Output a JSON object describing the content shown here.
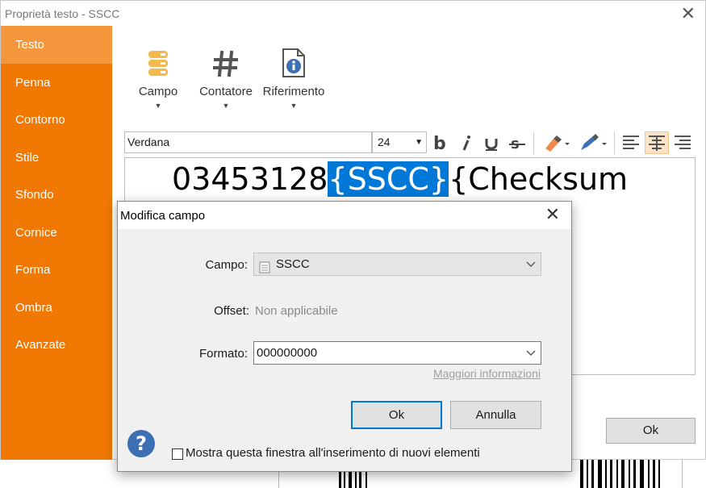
{
  "window": {
    "title": "Proprietà testo - SSCC",
    "close": "✕"
  },
  "sidebar": {
    "items": [
      {
        "label": "Testo"
      },
      {
        "label": "Penna"
      },
      {
        "label": "Contorno"
      },
      {
        "label": "Stile"
      },
      {
        "label": "Sfondo"
      },
      {
        "label": "Cornice"
      },
      {
        "label": "Forma"
      },
      {
        "label": "Ombra"
      },
      {
        "label": "Avanzate"
      }
    ],
    "active": "Testo"
  },
  "toolbar": {
    "campo": "Campo",
    "contatore": "Contatore",
    "riferimento": "Riferimento",
    "dropdown_arrow": "▼"
  },
  "format": {
    "font": "Verdana",
    "size": "24",
    "arrow": "▼"
  },
  "editor": {
    "prefix": "03453128",
    "selected": "{SSCC}",
    "suffix": "{Checksum"
  },
  "main_ok": "Ok",
  "dialog": {
    "title": "Modifica campo",
    "close": "✕",
    "campo_label": "Campo:",
    "campo_value": "SSCC",
    "offset_label": "Offset:",
    "offset_value": "Non applicabile",
    "formato_label": "Formato:",
    "formato_value": "000000000",
    "more_info": "Maggiori informazioni",
    "ok": "Ok",
    "cancel": "Annulla",
    "checkbox_label": "Mostra questa finestra all'inserimento di nuovi elementi",
    "help": "?",
    "chevron": "⌵"
  },
  "colors": {
    "accent": "#f07803",
    "accent_light": "#f4963c",
    "selection": "#0078d7",
    "help": "#3c6fb4"
  }
}
